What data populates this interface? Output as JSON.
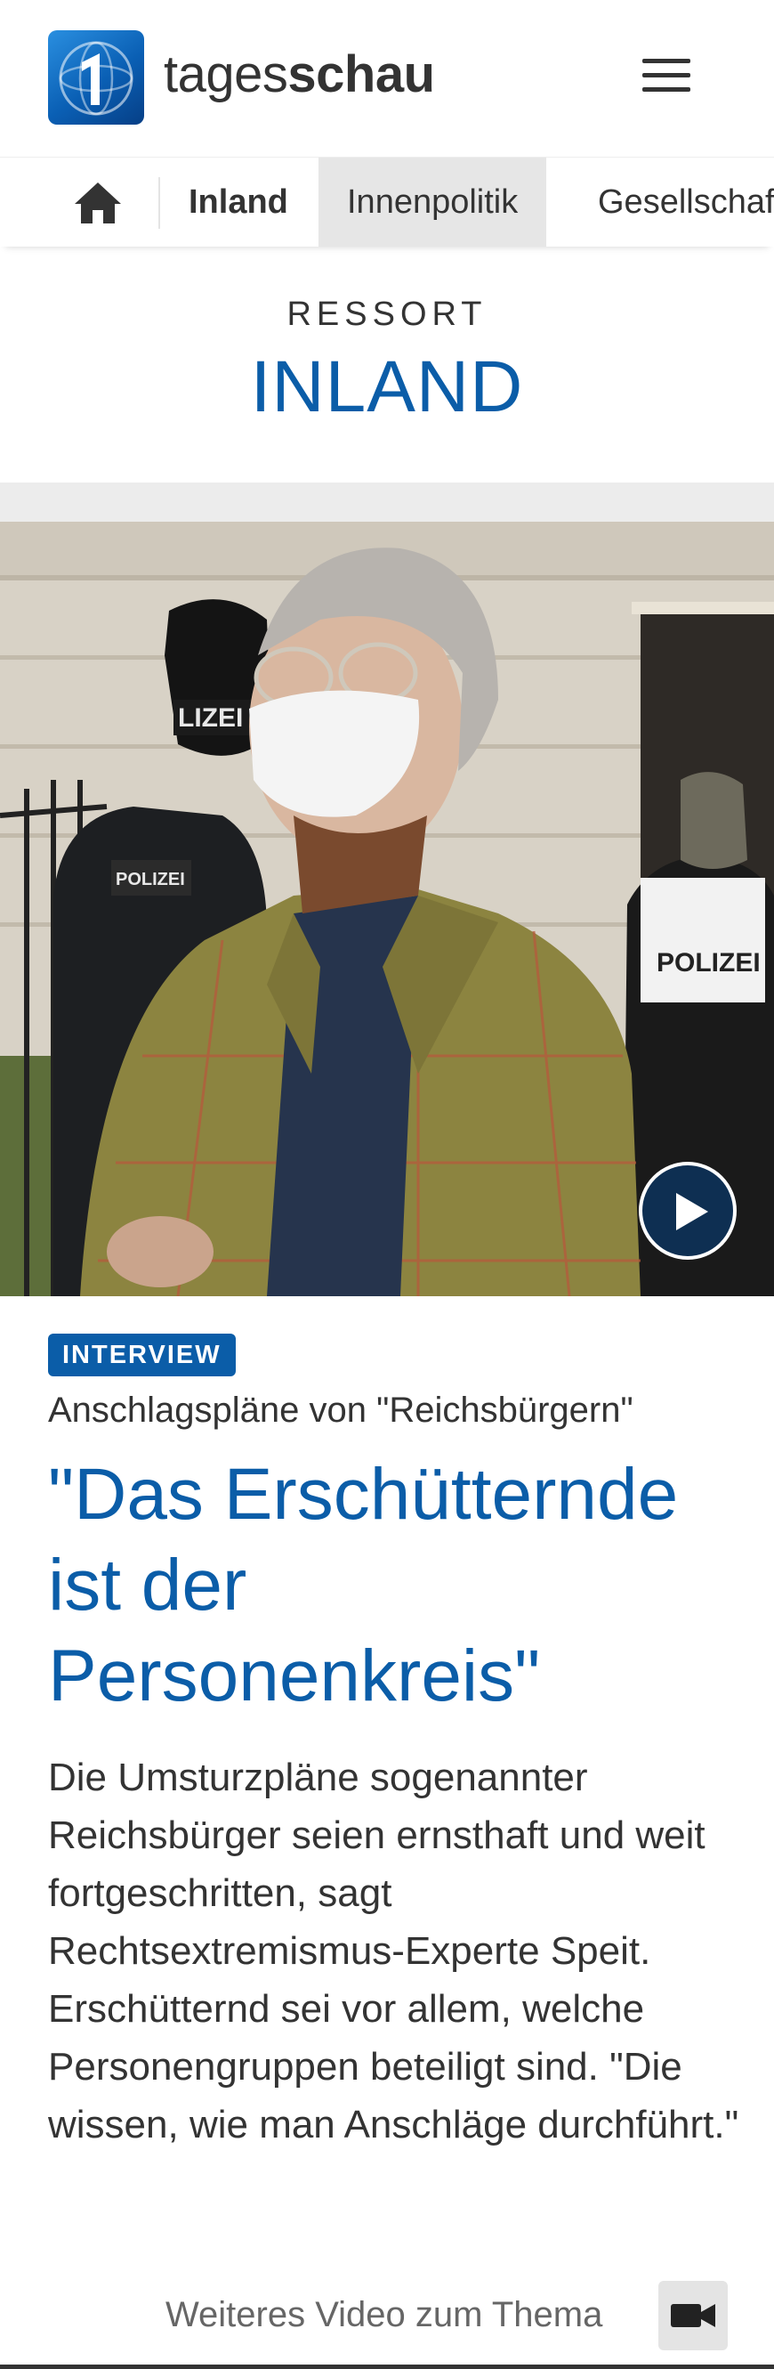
{
  "header": {
    "logo_text_regular": "tages",
    "logo_text_bold": "schau",
    "logo_icon": "tagesschau-globe-icon",
    "menu_icon": "hamburger-menu-icon"
  },
  "nav": {
    "home_icon": "home-icon",
    "items": [
      {
        "label": "Inland",
        "bold": true,
        "active": false
      },
      {
        "label": "Innenpolitik",
        "bold": false,
        "active": true
      },
      {
        "label": "Gesellschaft",
        "bold": false,
        "active": false
      }
    ]
  },
  "ressort": {
    "label": "RESSORT",
    "title": "INLAND"
  },
  "article": {
    "badge": "INTERVIEW",
    "kicker": "Anschlagspläne von \"Reichsbürgern\"",
    "headline": "\"Das Erschütternde ist der Personenkreis\"",
    "teaser": "Die Umsturzpläne sogenannter Reichsbürger seien ernsthaft und weit fortgeschritten, sagt Rechtsextremismus-Experte Speit. Erschütternd sei vor allem, welche Personengruppen beteiligt sind. \"Die wissen, wie man Anschläge durchführt.\"",
    "image_text_left": "LIZEI",
    "image_text_vest": "POLIZEI",
    "image_text_right": "POLIZEI",
    "play_icon": "play-icon"
  },
  "more_video": {
    "label": "Weiteres Video zum Thema",
    "icon": "video-camera-icon"
  },
  "colors": {
    "brand_blue": "#0b5da8",
    "text_dark": "#333333",
    "nav_active_bg": "#e6e6e6"
  }
}
